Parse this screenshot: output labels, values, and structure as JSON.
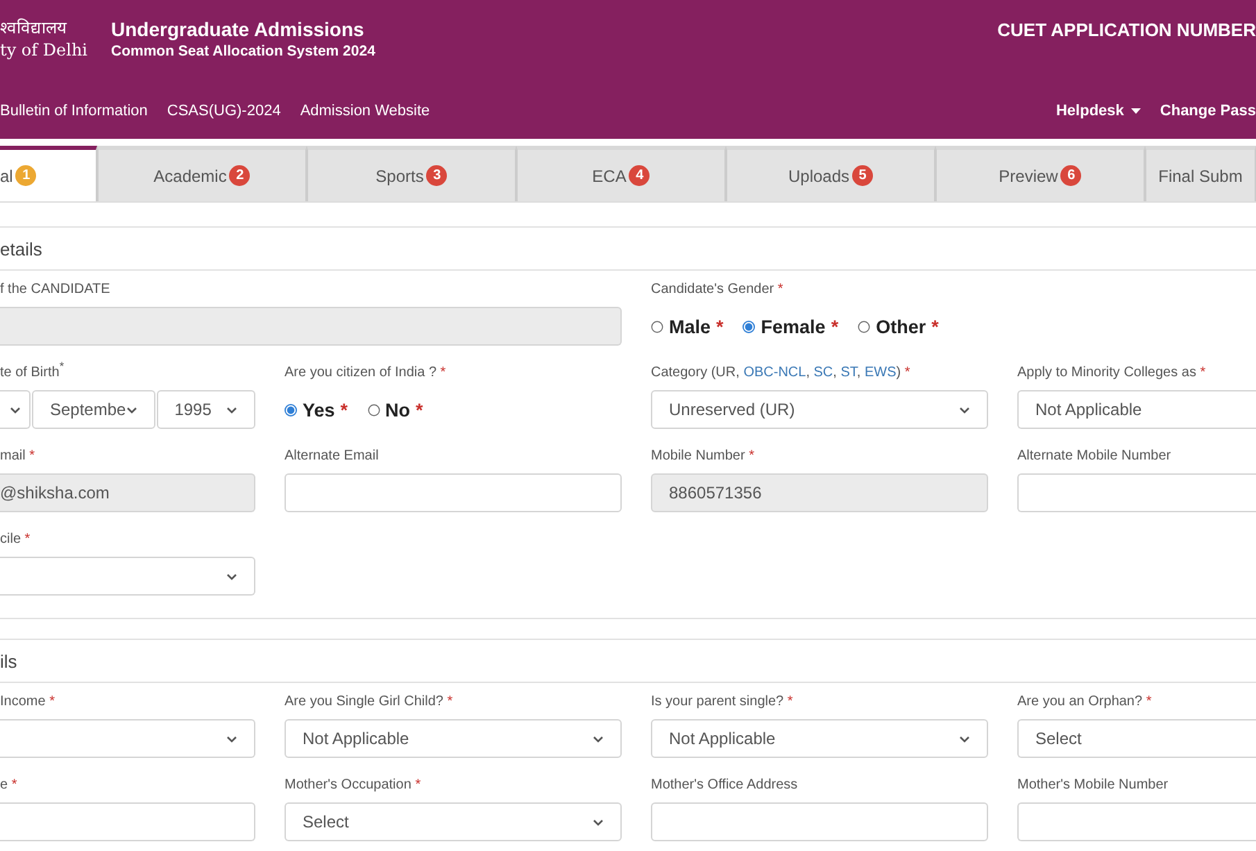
{
  "header": {
    "university_name_hindi": "श्वविद्यालय",
    "university_name": "ty of Delhi",
    "title": "Undergraduate Admissions",
    "subtitle": "Common Seat Allocation System 2024",
    "application_number_label": "CUET APPLICATION NUMBER",
    "nav_links": [
      "Bulletin of Information",
      "CSAS(UG)-2024",
      "Admission Website"
    ],
    "right_links": [
      {
        "label": "Helpdesk",
        "dropdown": true
      },
      {
        "label": "Change Pass",
        "dropdown": false
      }
    ]
  },
  "tabs": [
    {
      "label": "al",
      "step": "1",
      "selected": true
    },
    {
      "label": "Academic",
      "step": "2",
      "selected": false
    },
    {
      "label": "Sports",
      "step": "3",
      "selected": false
    },
    {
      "label": "ECA",
      "step": "4",
      "selected": false
    },
    {
      "label": "Uploads",
      "step": "5",
      "selected": false
    },
    {
      "label": "Preview",
      "step": "6",
      "selected": false
    },
    {
      "label": "Final Subm",
      "selected": false
    }
  ],
  "sections": [
    {
      "title": "etails",
      "rows": [
        [
          {
            "kind": "text",
            "label": "f the CANDIDATE",
            "disabled": true
          },
          "",
          {
            "kind": "radio",
            "label": "Candidate's Gender",
            "mark": "*",
            "options": [
              {
                "label": "Male",
                "mark": "*",
                "selected": false
              },
              {
                "label": "Female",
                "mark": "*",
                "selected": true
              },
              {
                "label": "Other",
                "mark": "*",
                "selected": false
              }
            ]
          }
        ],
        [
          {
            "kind": "date",
            "label": "te of Birth$^{*}$",
            "selects": [
              {
                "kind": "select"
              },
              {
                "kind": "select",
                "value": "Septembe"
              },
              {
                "kind": "select",
                "value": "1995"
              }
            ]
          },
          {
            "kind": "radio",
            "label": "Are you citizen of India ?",
            "mark": "*",
            "options": [
              {
                "label": "Yes",
                "mark": "*",
                "selected": true
              },
              {
                "label": "No",
                "mark": "*",
                "selected": false
              }
            ]
          },
          {
            "kind": "select",
            "label_parts": [
              {
                "text": "Category (UR, ",
                "link": false
              },
              {
                "text": "OBC-NCL",
                "link": true
              },
              {
                "text": ", ",
                "link": false
              },
              {
                "text": "SC",
                "link": true
              },
              {
                "text": ", ",
                "link": false
              },
              {
                "text": "ST",
                "link": true
              },
              {
                "text": ", ",
                "link": false
              },
              {
                "text": "EWS",
                "link": true
              },
              {
                "text": ")",
                "link": false
              }
            ],
            "mark": "*",
            "value": "Unreserved (UR)"
          },
          {
            "kind": "select",
            "label": "Apply to Minority Colleges as",
            "mark": "*",
            "value": "Not Applicable"
          }
        ],
        [
          {
            "kind": "text",
            "label": "mail",
            "mark": "*",
            "value": "@shiksha.com",
            "disabled": true
          },
          {
            "kind": "text",
            "label": "Alternate Email",
            "disabled": false
          },
          {
            "kind": "text",
            "label": "Mobile Number",
            "mark": "*",
            "value": "8860571356",
            "disabled": true
          },
          {
            "kind": "text",
            "label": "Alternate Mobile Number",
            "disabled": false
          }
        ],
        [
          {
            "kind": "select",
            "label": "cile",
            "mark": "*"
          }
        ]
      ]
    },
    {
      "title": "ils",
      "rows": [
        [
          {
            "kind": "select",
            "label": "Income",
            "mark": "*"
          },
          {
            "kind": "select",
            "label": "Are you Single Girl Child?",
            "mark": "*",
            "value": "Not Applicable"
          },
          {
            "kind": "select",
            "label": "Is your parent single?",
            "mark": "*",
            "value": "Not Applicable"
          },
          {
            "kind": "select",
            "label": "Are you an Orphan?",
            "mark": "*",
            "value": "Select"
          }
        ],
        [
          {
            "kind": "text",
            "label": "e",
            "mark": "*",
            "disabled": false
          },
          {
            "kind": "select",
            "label": "Mother's Occupation",
            "mark": "*",
            "value": "Select"
          },
          {
            "kind": "text",
            "label": "Mother's Office Address",
            "disabled": false
          },
          {
            "kind": "text",
            "label": "Mother's Mobile Number",
            "disabled": false
          }
        ]
      ]
    }
  ]
}
